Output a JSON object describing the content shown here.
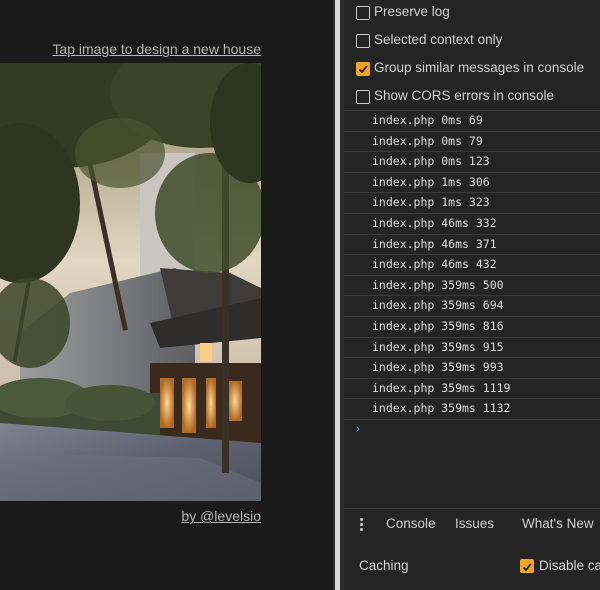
{
  "page": {
    "design_link": "Tap image to design a new house",
    "credit_link": "by @levelsio"
  },
  "devtools": {
    "options": [
      {
        "label": "Preserve log",
        "checked": false
      },
      {
        "label": "Selected context only",
        "checked": false
      },
      {
        "label": "Group similar messages in console",
        "checked": true
      },
      {
        "label": "Show CORS errors in console",
        "checked": false
      }
    ],
    "console_rows": [
      "index.php 0ms 69",
      "index.php 0ms 79",
      "index.php 0ms 123",
      "index.php 1ms 306",
      "index.php 1ms 323",
      "index.php 46ms 332",
      "index.php 46ms 371",
      "index.php 46ms 432",
      "index.php 359ms 500",
      "index.php 359ms 694",
      "index.php 359ms 816",
      "index.php 359ms 915",
      "index.php 359ms 993",
      "index.php 359ms 1119",
      "index.php 359ms 1132"
    ],
    "prompt_symbol": "›",
    "drawer_tabs": {
      "console": "Console",
      "issues": "Issues",
      "whats_new": "What's New"
    },
    "network": {
      "caching_label": "Caching",
      "disable_cache_label": "Disable ca",
      "disable_cache_checked": true
    },
    "colors": {
      "accent": "#f2a521",
      "prompt": "#4a8cf0",
      "background": "#242424"
    }
  }
}
